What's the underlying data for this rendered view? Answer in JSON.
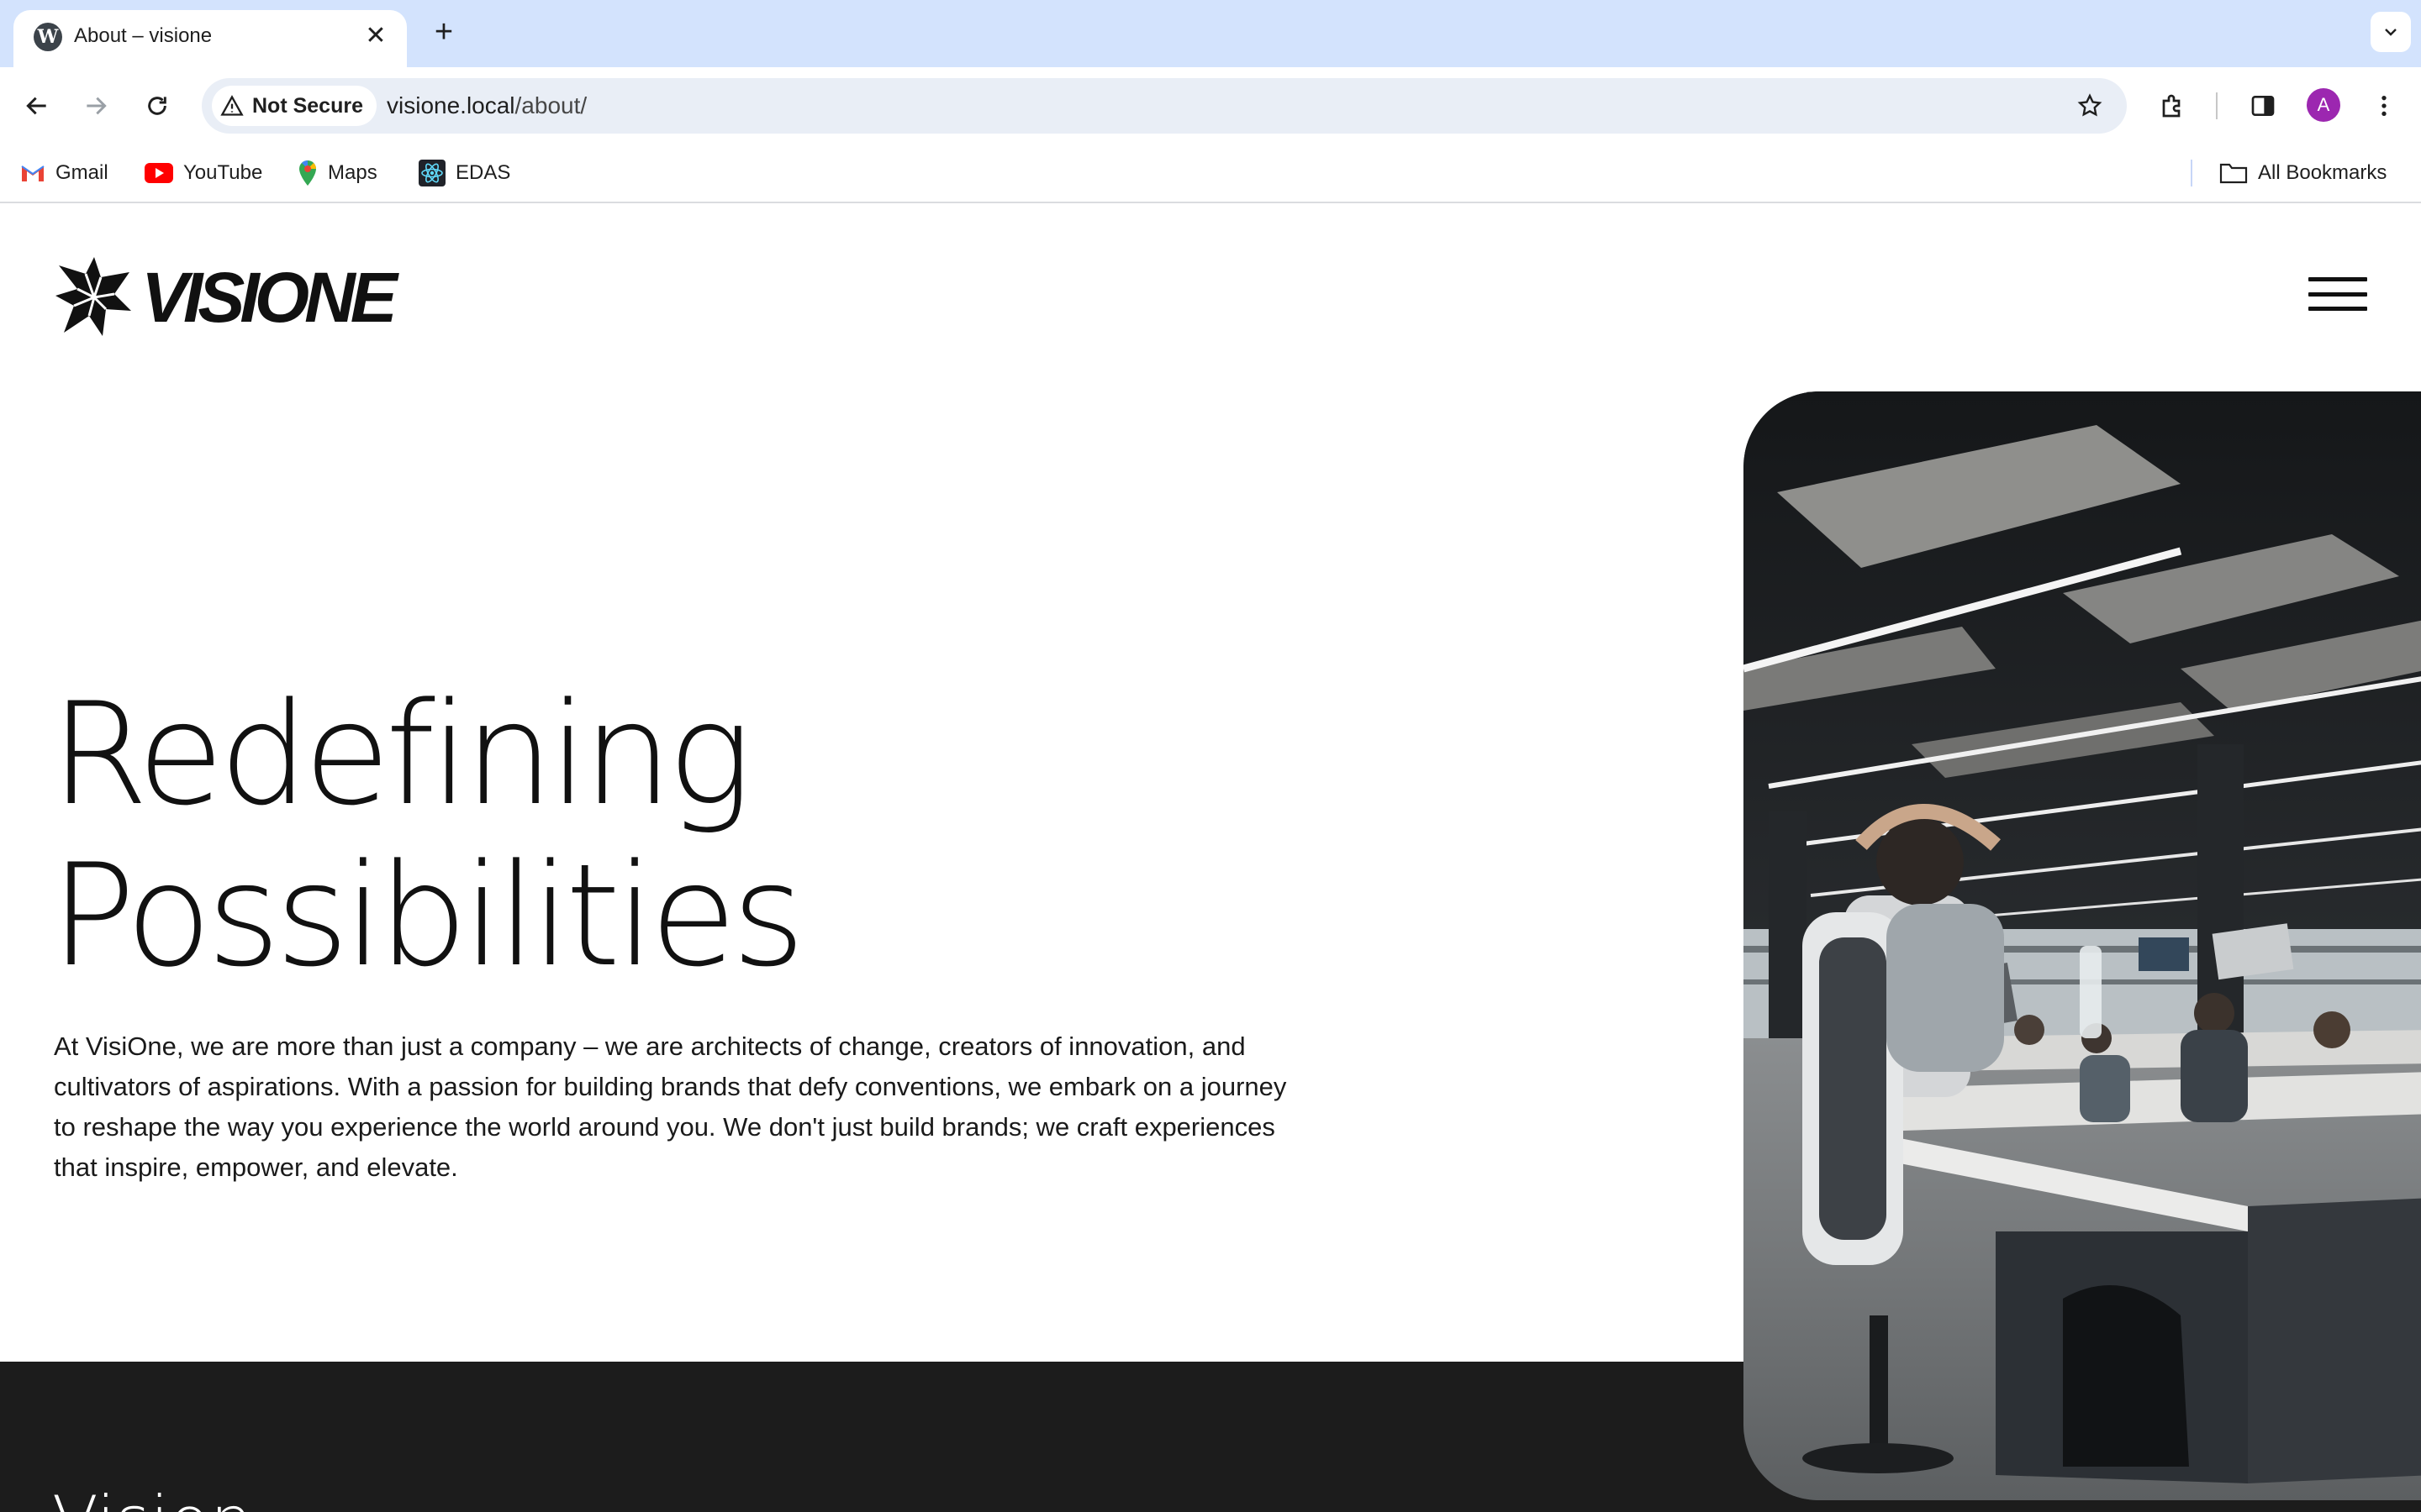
{
  "browser": {
    "tab": {
      "title": "About – visione"
    },
    "omnibox": {
      "security_label": "Not Secure",
      "url_host": "visione.local",
      "url_path": "/about/"
    },
    "profile_initial": "A",
    "bookmarks": [
      {
        "label": "Gmail",
        "icon": "gmail-icon"
      },
      {
        "label": "YouTube",
        "icon": "youtube-icon"
      },
      {
        "label": "Maps",
        "icon": "maps-icon"
      },
      {
        "label": "EDAS",
        "icon": "react-icon"
      }
    ],
    "all_bookmarks_label": "All Bookmarks"
  },
  "site": {
    "logo_text": "VISIONE",
    "hero": {
      "title_line1": "Redefining",
      "title_line2": "Possibilities",
      "body": "At VisiOne, we are more than just a company – we are architects of change, creators of innovation, and cultivators of aspirations. With a passion for building brands that defy conventions, we embark on a journey to reshape the way you experience the world around you. We don't just build brands; we craft experiences that inspire, empower, and elevate."
    },
    "next_section_heading": "Vision"
  },
  "colors": {
    "tabbar_bg": "#d3e3fd",
    "omnibox_bg": "#e9eef6",
    "page_text": "#111111",
    "dark_band": "#1c1c1c",
    "avatar": "#9c27b0"
  }
}
